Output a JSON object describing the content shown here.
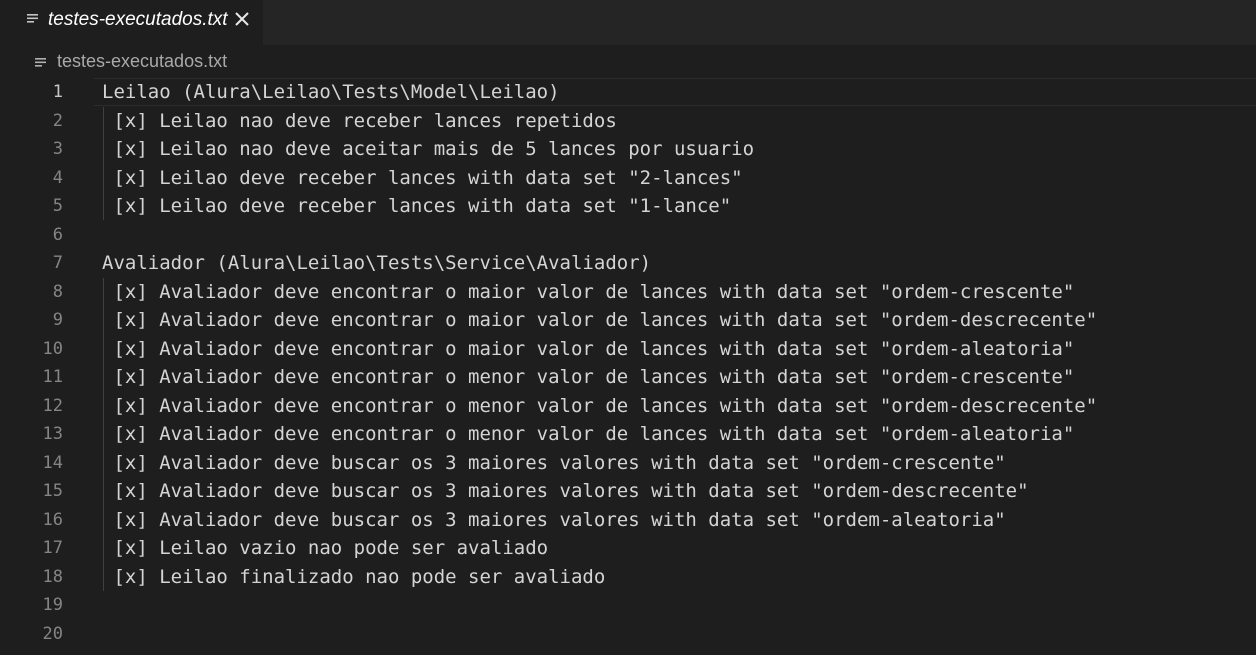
{
  "tab": {
    "title": "testes-executados.txt",
    "icon": "file-lines-icon",
    "close_icon": "close-icon"
  },
  "breadcrumb": {
    "label": "testes-executados.txt",
    "icon": "file-lines-icon"
  },
  "editor": {
    "active_line": 1,
    "lines": [
      {
        "n": "1",
        "text": "Leilao (Alura\\Leilao\\Tests\\Model\\Leilao)"
      },
      {
        "n": "2",
        "text": " [x] Leilao nao deve receber lances repetidos"
      },
      {
        "n": "3",
        "text": " [x] Leilao nao deve aceitar mais de 5 lances por usuario"
      },
      {
        "n": "4",
        "text": " [x] Leilao deve receber lances with data set \"2-lances\""
      },
      {
        "n": "5",
        "text": " [x] Leilao deve receber lances with data set \"1-lance\""
      },
      {
        "n": "6",
        "text": ""
      },
      {
        "n": "7",
        "text": "Avaliador (Alura\\Leilao\\Tests\\Service\\Avaliador)"
      },
      {
        "n": "8",
        "text": " [x] Avaliador deve encontrar o maior valor de lances with data set \"ordem-crescente\""
      },
      {
        "n": "9",
        "text": " [x] Avaliador deve encontrar o maior valor de lances with data set \"ordem-descrecente\""
      },
      {
        "n": "10",
        "text": " [x] Avaliador deve encontrar o maior valor de lances with data set \"ordem-aleatoria\""
      },
      {
        "n": "11",
        "text": " [x] Avaliador deve encontrar o menor valor de lances with data set \"ordem-crescente\""
      },
      {
        "n": "12",
        "text": " [x] Avaliador deve encontrar o menor valor de lances with data set \"ordem-descrecente\""
      },
      {
        "n": "13",
        "text": " [x] Avaliador deve encontrar o menor valor de lances with data set \"ordem-aleatoria\""
      },
      {
        "n": "14",
        "text": " [x] Avaliador deve buscar os 3 maiores valores with data set \"ordem-crescente\""
      },
      {
        "n": "15",
        "text": " [x] Avaliador deve buscar os 3 maiores valores with data set \"ordem-descrecente\""
      },
      {
        "n": "16",
        "text": " [x] Avaliador deve buscar os 3 maiores valores with data set \"ordem-aleatoria\""
      },
      {
        "n": "17",
        "text": " [x] Leilao vazio nao pode ser avaliado"
      },
      {
        "n": "18",
        "text": " [x] Leilao finalizado nao pode ser avaliado"
      },
      {
        "n": "19",
        "text": ""
      },
      {
        "n": "20",
        "text": ""
      }
    ]
  }
}
